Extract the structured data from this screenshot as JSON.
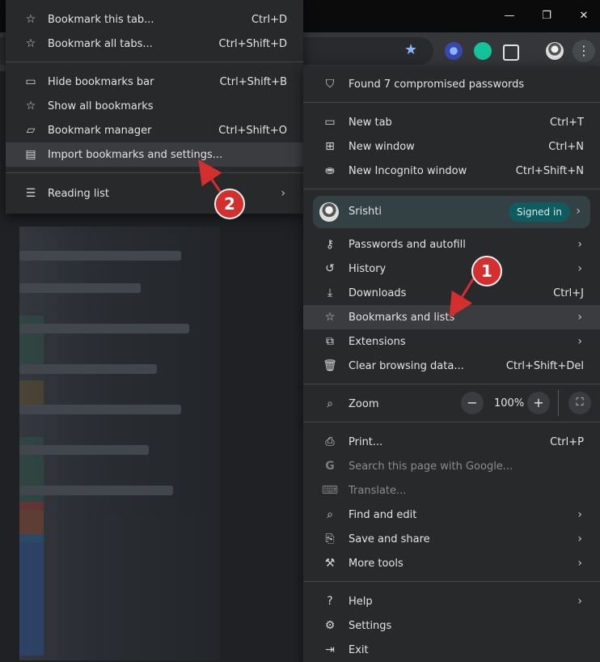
{
  "window_controls": {
    "minimize": "—",
    "maximize": "❐",
    "close": "✕"
  },
  "left_menu": {
    "items": [
      {
        "id": "bookmark-tab",
        "label": "Bookmark this tab...",
        "shortcut": "Ctrl+D",
        "icon": "star-icon"
      },
      {
        "id": "bookmark-all",
        "label": "Bookmark all tabs...",
        "shortcut": "Ctrl+Shift+D",
        "icon": "star-icon"
      },
      {
        "id": "hide-bar",
        "label": "Hide bookmarks bar",
        "shortcut": "Ctrl+Shift+B",
        "icon": "bookmarks-bar-icon"
      },
      {
        "id": "show-all",
        "label": "Show all bookmarks",
        "shortcut": "",
        "icon": "star-icon"
      },
      {
        "id": "manager",
        "label": "Bookmark manager",
        "shortcut": "Ctrl+Shift+O",
        "icon": "folder-icon"
      },
      {
        "id": "import",
        "label": "Import bookmarks and settings...",
        "shortcut": "",
        "icon": "import-icon"
      },
      {
        "id": "reading-list",
        "label": "Reading list",
        "shortcut": "",
        "icon": "reading-list-icon"
      }
    ]
  },
  "right_menu": {
    "alert": "Found 7 compromised passwords",
    "items_a": [
      {
        "label": "New tab",
        "shortcut": "Ctrl+T"
      },
      {
        "label": "New window",
        "shortcut": "Ctrl+N"
      },
      {
        "label": "New Incognito window",
        "shortcut": "Ctrl+Shift+N"
      }
    ],
    "profile": {
      "name": "Srishti",
      "status": "Signed in"
    },
    "items_b": [
      {
        "label": "Passwords and autofill",
        "shortcut": ""
      },
      {
        "label": "History",
        "shortcut": ""
      },
      {
        "label": "Downloads",
        "shortcut": "Ctrl+J"
      },
      {
        "label": "Bookmarks and lists",
        "shortcut": ""
      },
      {
        "label": "Extensions",
        "shortcut": ""
      },
      {
        "label": "Clear browsing data...",
        "shortcut": "Ctrl+Shift+Del"
      }
    ],
    "zoom": {
      "label": "Zoom",
      "minus": "−",
      "value": "100%",
      "plus": "+"
    },
    "items_c": [
      {
        "label": "Print...",
        "shortcut": "Ctrl+P"
      },
      {
        "label": "Search this page with Google...",
        "shortcut": ""
      },
      {
        "label": "Translate...",
        "shortcut": ""
      },
      {
        "label": "Find and edit",
        "shortcut": ""
      },
      {
        "label": "Save and share",
        "shortcut": ""
      },
      {
        "label": "More tools",
        "shortcut": ""
      }
    ],
    "items_d": [
      {
        "label": "Help",
        "shortcut": ""
      },
      {
        "label": "Settings",
        "shortcut": ""
      },
      {
        "label": "Exit",
        "shortcut": ""
      }
    ]
  },
  "annotations": {
    "step1": "1",
    "step2": "2",
    "color": "#d32f2f"
  }
}
